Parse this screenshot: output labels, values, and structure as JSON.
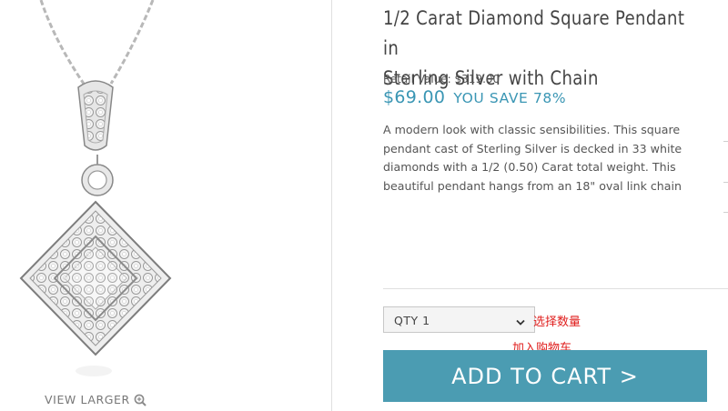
{
  "product": {
    "title": "1/2 Carat Diamond Square Pendant in\nSterling Silver with Chain",
    "retail_value": "Retail Value: $319.00",
    "price": "$69.00",
    "you_save": "YOU SAVE 78%",
    "description": "A modern look with classic sensibilities. This square pendant cast of Sterling Silver is decked in 33 white diamonds with a 1/2 (0.50) Carat total weight. This beautiful pendant hangs from an 18\" oval link chain"
  },
  "image": {
    "view_larger": "VIEW LARGER",
    "zoom_icon": "magnifier-plus-icon"
  },
  "purchase": {
    "qty_selected": "QTY 1",
    "add_to_cart": "ADD TO CART >"
  },
  "annotations": {
    "select_qty": "选择数量",
    "add_to_cart": "加入购物车"
  },
  "colors": {
    "accent": "#3a96b4",
    "button": "#4b9cb2",
    "annotation": "#e0201f"
  }
}
